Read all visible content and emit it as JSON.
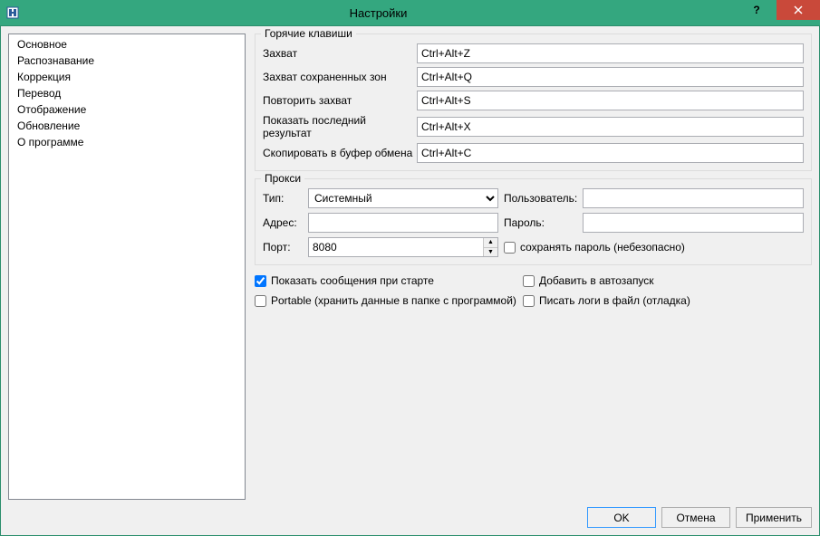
{
  "window": {
    "title": "Настройки"
  },
  "sidebar": {
    "items": [
      "Основное",
      "Распознавание",
      "Коррекция",
      "Перевод",
      "Отображение",
      "Обновление",
      "О программе"
    ]
  },
  "hotkeys": {
    "group_title": "Горячие клавиши",
    "rows": [
      {
        "label": "Захват",
        "value": "Ctrl+Alt+Z"
      },
      {
        "label": "Захват сохраненных зон",
        "value": "Ctrl+Alt+Q"
      },
      {
        "label": "Повторить захват",
        "value": "Ctrl+Alt+S"
      },
      {
        "label": "Показать последний результат",
        "value": "Ctrl+Alt+X"
      },
      {
        "label": "Скопировать в буфер обмена",
        "value": "Ctrl+Alt+C"
      }
    ]
  },
  "proxy": {
    "group_title": "Прокси",
    "type_label": "Тип:",
    "type_value": "Системный",
    "user_label": "Пользователь:",
    "user_value": "",
    "address_label": "Адрес:",
    "address_value": "",
    "password_label": "Пароль:",
    "password_value": "",
    "port_label": "Порт:",
    "port_value": "8080",
    "save_password_label": "сохранять пароль (небезопасно)",
    "save_password_checked": false
  },
  "options": {
    "show_messages": {
      "label": "Показать сообщения при старте",
      "checked": true
    },
    "autostart": {
      "label": "Добавить в автозапуск",
      "checked": false
    },
    "portable": {
      "label": "Portable (хранить данные в папке с программой)",
      "checked": false
    },
    "write_logs": {
      "label": "Писать логи в файл (отладка)",
      "checked": false
    }
  },
  "buttons": {
    "ok": "OK",
    "cancel": "Отмена",
    "apply": "Применить"
  }
}
